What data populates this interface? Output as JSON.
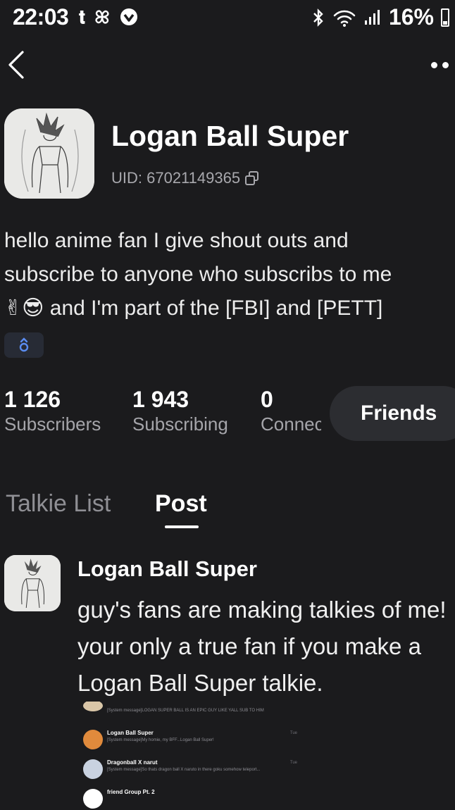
{
  "status_bar": {
    "time": "22:03",
    "battery": "16%",
    "left_icons": [
      "t-icon",
      "pinwheel-icon",
      "vpn-shield-icon"
    ],
    "right_icons": [
      "bluetooth-icon",
      "wifi-icon",
      "signal-icon",
      "battery-icon"
    ]
  },
  "profile": {
    "name": "Logan Ball Super",
    "uid": "UID: 67021149365",
    "bio_line1": "hello anime fan I give shout outs and",
    "bio_line2": "subscribe to anyone who subscribs to me",
    "bio_emojis": "✌😎",
    "bio_line3": "and I'm part of the [FBI] and [PETT]",
    "badge_icon": "gender-male-icon"
  },
  "stats": [
    {
      "value": "1 126",
      "label": "Subscribers"
    },
    {
      "value": "1 943",
      "label": "Subscribing"
    },
    {
      "value": "0",
      "label": "Connections"
    }
  ],
  "friends_button": "Friends",
  "tabs": [
    {
      "label": "Talkie List",
      "active": false
    },
    {
      "label": "Post",
      "active": true
    }
  ],
  "post": {
    "author": "Logan Ball Super",
    "text": "guy's fans are making talkies of me!\nyour only a true fan if you make a\nLogan Ball Super talkie.",
    "embedded_chat": [
      {
        "title": "",
        "message": "[System message]LOGAN SUPER BALL IS AN EPIC GUY LIKE YALL SUB TO HIM",
        "time": ""
      },
      {
        "title": "Logan Ball Super",
        "message": "[System message]My homie, my BFF...Logan Ball Super!",
        "time": "Tue"
      },
      {
        "title": "Dragonball X narut",
        "message": "[System message]So thats dragon ball X naruto in there goku somehow teleport...",
        "time": "Tue"
      },
      {
        "title": "friend Group Pt. 2",
        "message": "",
        "time": ""
      }
    ]
  },
  "colors": {
    "background": "#1b1b1d",
    "secondary_text": "#a5a5aa",
    "pill": "#2c2d31",
    "badge": "#272b35",
    "badge_icon": "#5a8cf0"
  }
}
